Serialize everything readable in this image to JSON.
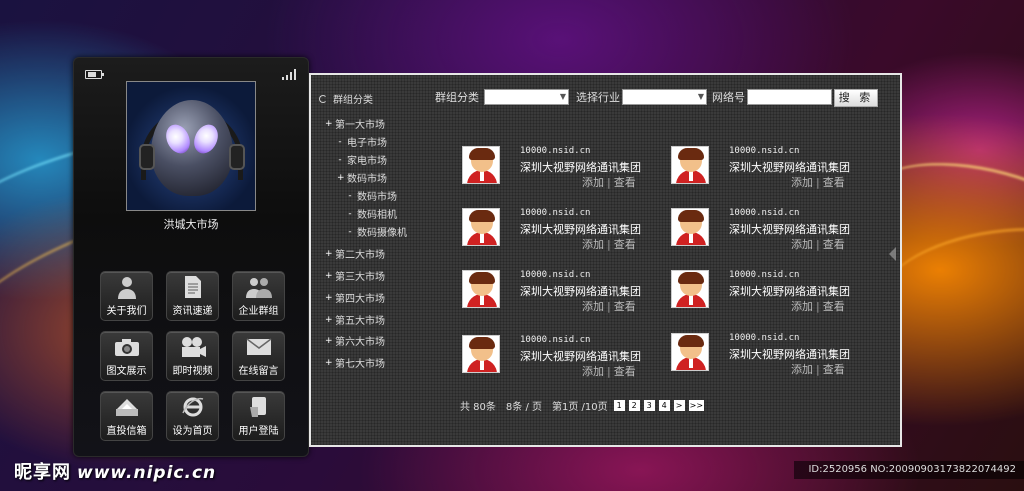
{
  "phone": {
    "caption": "洪城大市场",
    "tiles": [
      {
        "label": "关于我们",
        "icon": "user-icon"
      },
      {
        "label": "资讯速递",
        "icon": "document-icon"
      },
      {
        "label": "企业群组",
        "icon": "group-icon"
      },
      {
        "label": "图文展示",
        "icon": "camera-icon"
      },
      {
        "label": "即时视频",
        "icon": "video-camera-icon"
      },
      {
        "label": "在线留言",
        "icon": "envelope-icon"
      },
      {
        "label": "直投信箱",
        "icon": "mailbox-icon"
      },
      {
        "label": "设为首页",
        "icon": "ie-icon"
      },
      {
        "label": "用户登陆",
        "icon": "login-hand-icon"
      }
    ]
  },
  "sidebar": {
    "title": "群组分类",
    "items": [
      {
        "mark": "+",
        "label": "第一大市场"
      },
      {
        "mark": "-",
        "label": "电子市场"
      },
      {
        "mark": "-",
        "label": "家电市场"
      },
      {
        "mark": "+",
        "label": "数码市场"
      },
      {
        "mark": "-",
        "label": "数码市场"
      },
      {
        "mark": "-",
        "label": "数码相机"
      },
      {
        "mark": "-",
        "label": "数码摄像机"
      },
      {
        "mark": "+",
        "label": "第二大市场"
      },
      {
        "mark": "+",
        "label": "第三大市场"
      },
      {
        "mark": "+",
        "label": "第四大市场"
      },
      {
        "mark": "+",
        "label": "第五大市场"
      },
      {
        "mark": "+",
        "label": "第六大市场"
      },
      {
        "mark": "+",
        "label": "第七大市场"
      }
    ]
  },
  "filters": {
    "group_label": "群组分类",
    "industry_label": "选择行业",
    "network_label": "网络号",
    "search_button": "搜 索"
  },
  "cards": [
    {
      "url": "10000.nsid.cn",
      "company": "深圳大视野网络通讯集团",
      "add": "添加",
      "view": "查看"
    },
    {
      "url": "10000.nsid.cn",
      "company": "深圳大视野网络通讯集团",
      "add": "添加",
      "view": "查看"
    },
    {
      "url": "10000.nsid.cn",
      "company": "深圳大视野网络通讯集团",
      "add": "添加",
      "view": "查看"
    },
    {
      "url": "10000.nsid.cn",
      "company": "深圳大视野网络通讯集团",
      "add": "添加",
      "view": "查看"
    },
    {
      "url": "10000.nsid.cn",
      "company": "深圳大视野网络通讯集团",
      "add": "添加",
      "view": "查看"
    },
    {
      "url": "10000.nsid.cn",
      "company": "深圳大视野网络通讯集团",
      "add": "添加",
      "view": "查看"
    },
    {
      "url": "10000.nsid.cn",
      "company": "深圳大视野网络通讯集团",
      "add": "添加",
      "view": "查看"
    },
    {
      "url": "10000.nsid.cn",
      "company": "深圳大视野网络通讯集团",
      "add": "添加",
      "view": "查看"
    }
  ],
  "pager": {
    "total": "共 80条",
    "per_page": "8条 / 页",
    "current": "第1页 /10页",
    "pages": [
      "1",
      "2",
      "3",
      "4",
      ">",
      ">>"
    ]
  },
  "watermark": {
    "brand": "昵享网",
    "site": "www.nipic.cn",
    "id": "ID:2520956 NO:20090903173822074492"
  }
}
